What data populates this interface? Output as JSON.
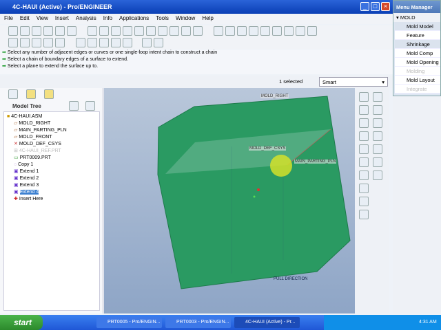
{
  "window": {
    "title": "4C-HAUI (Active) - Pro/ENGINEER",
    "min": "_",
    "max": "□",
    "close": "×"
  },
  "menu": [
    "File",
    "Edit",
    "View",
    "Insert",
    "Analysis",
    "Info",
    "Applications",
    "Tools",
    "Window",
    "Help"
  ],
  "messages": [
    "Select any number of adjacent edges or curves or one single-loop intent chain to construct a chain",
    "Select a chain of boundary edges of a surface to extend.",
    "Select a plane to extend the surface up to."
  ],
  "status": {
    "selected": "1 selected",
    "filter": "Smart"
  },
  "model_tree": {
    "title": "Model Tree",
    "items": [
      "4C-HAUI.ASM",
      "MOLD_RIGHT",
      "MAIN_PARTING_PLN",
      "MOLD_FRONT",
      "MOLD_DEF_CSYS",
      "4C-HAUI_REF.PRT",
      "PRT0009.PRT",
      "Copy 1",
      "Extend 1",
      "Extend 2",
      "Extend 3",
      "Extend 4",
      "Insert Here"
    ]
  },
  "viewport": {
    "labels": [
      "MOLD_RIGHT",
      "MOLD_DEF_CSYS",
      "MAIN_PARTING_PLN",
      "PULL DIRECTION"
    ]
  },
  "menu_manager": {
    "title": "Menu Manager",
    "section": "MOLD",
    "items": [
      "Mold Model",
      "Feature",
      "Shrinkage",
      "Mold Comp",
      "Mold Opening",
      "Molding",
      "Mold Layout",
      "Integrate"
    ]
  },
  "taskbar": {
    "start": "start",
    "tasks": [
      "PRT0005 - Pro/ENGIN...",
      "PRT0003 - Pro/ENGIN...",
      "4C-HAUI (Active) - Pr..."
    ],
    "clock": "4:31 AM"
  }
}
